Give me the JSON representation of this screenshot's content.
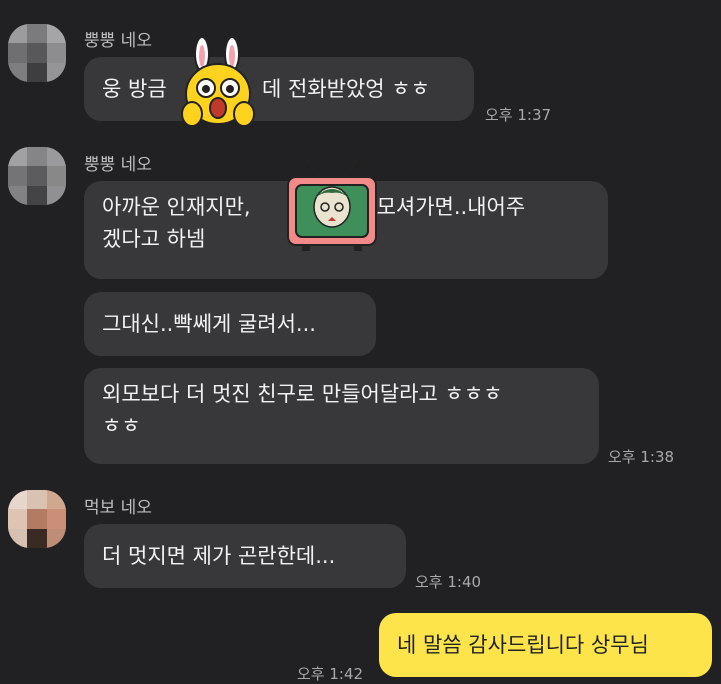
{
  "colors": {
    "background": "#212123",
    "incoming_bubble": "#38383b",
    "outgoing_bubble": "#fde44b",
    "sender_text": "#bdbdbf",
    "time_text": "#a9a9ab"
  },
  "messages": [
    {
      "sender": "뿡뿡 네오",
      "avatar": "blurred-profile-photo",
      "bubbles": [
        {
          "lines": [
            "웅 방금",
            "데 전화받았엉 ㅎㅎ"
          ],
          "sticker": "rabbit-emoticon"
        }
      ],
      "time": "오후 1:37"
    },
    {
      "sender": "뿡뿡 네오",
      "avatar": "blurred-profile-photo",
      "bubbles": [
        {
          "lines": [
            "아까운 인재지만,",
            "가 모셔가면..내어주",
            "겠다고 하넴"
          ],
          "sticker": "tv-emoticon"
        },
        {
          "lines": [
            "그대신..빡쎄게 굴려서..."
          ]
        },
        {
          "lines": [
            "외모보다 더 멋진 친구로 만들어달라고 ㅎㅎㅎ",
            "ㅎㅎ"
          ]
        }
      ],
      "time": "오후 1:38"
    },
    {
      "sender": "먹보 네오",
      "avatar": "blurred-profile-photo",
      "bubbles": [
        {
          "lines": [
            "더 멋지면 제가 곤란한데..."
          ]
        }
      ],
      "time": "오후 1:40"
    }
  ],
  "my_message": {
    "text": "네 말씀 감사드립니다 상무님",
    "time": "오후 1:42"
  }
}
